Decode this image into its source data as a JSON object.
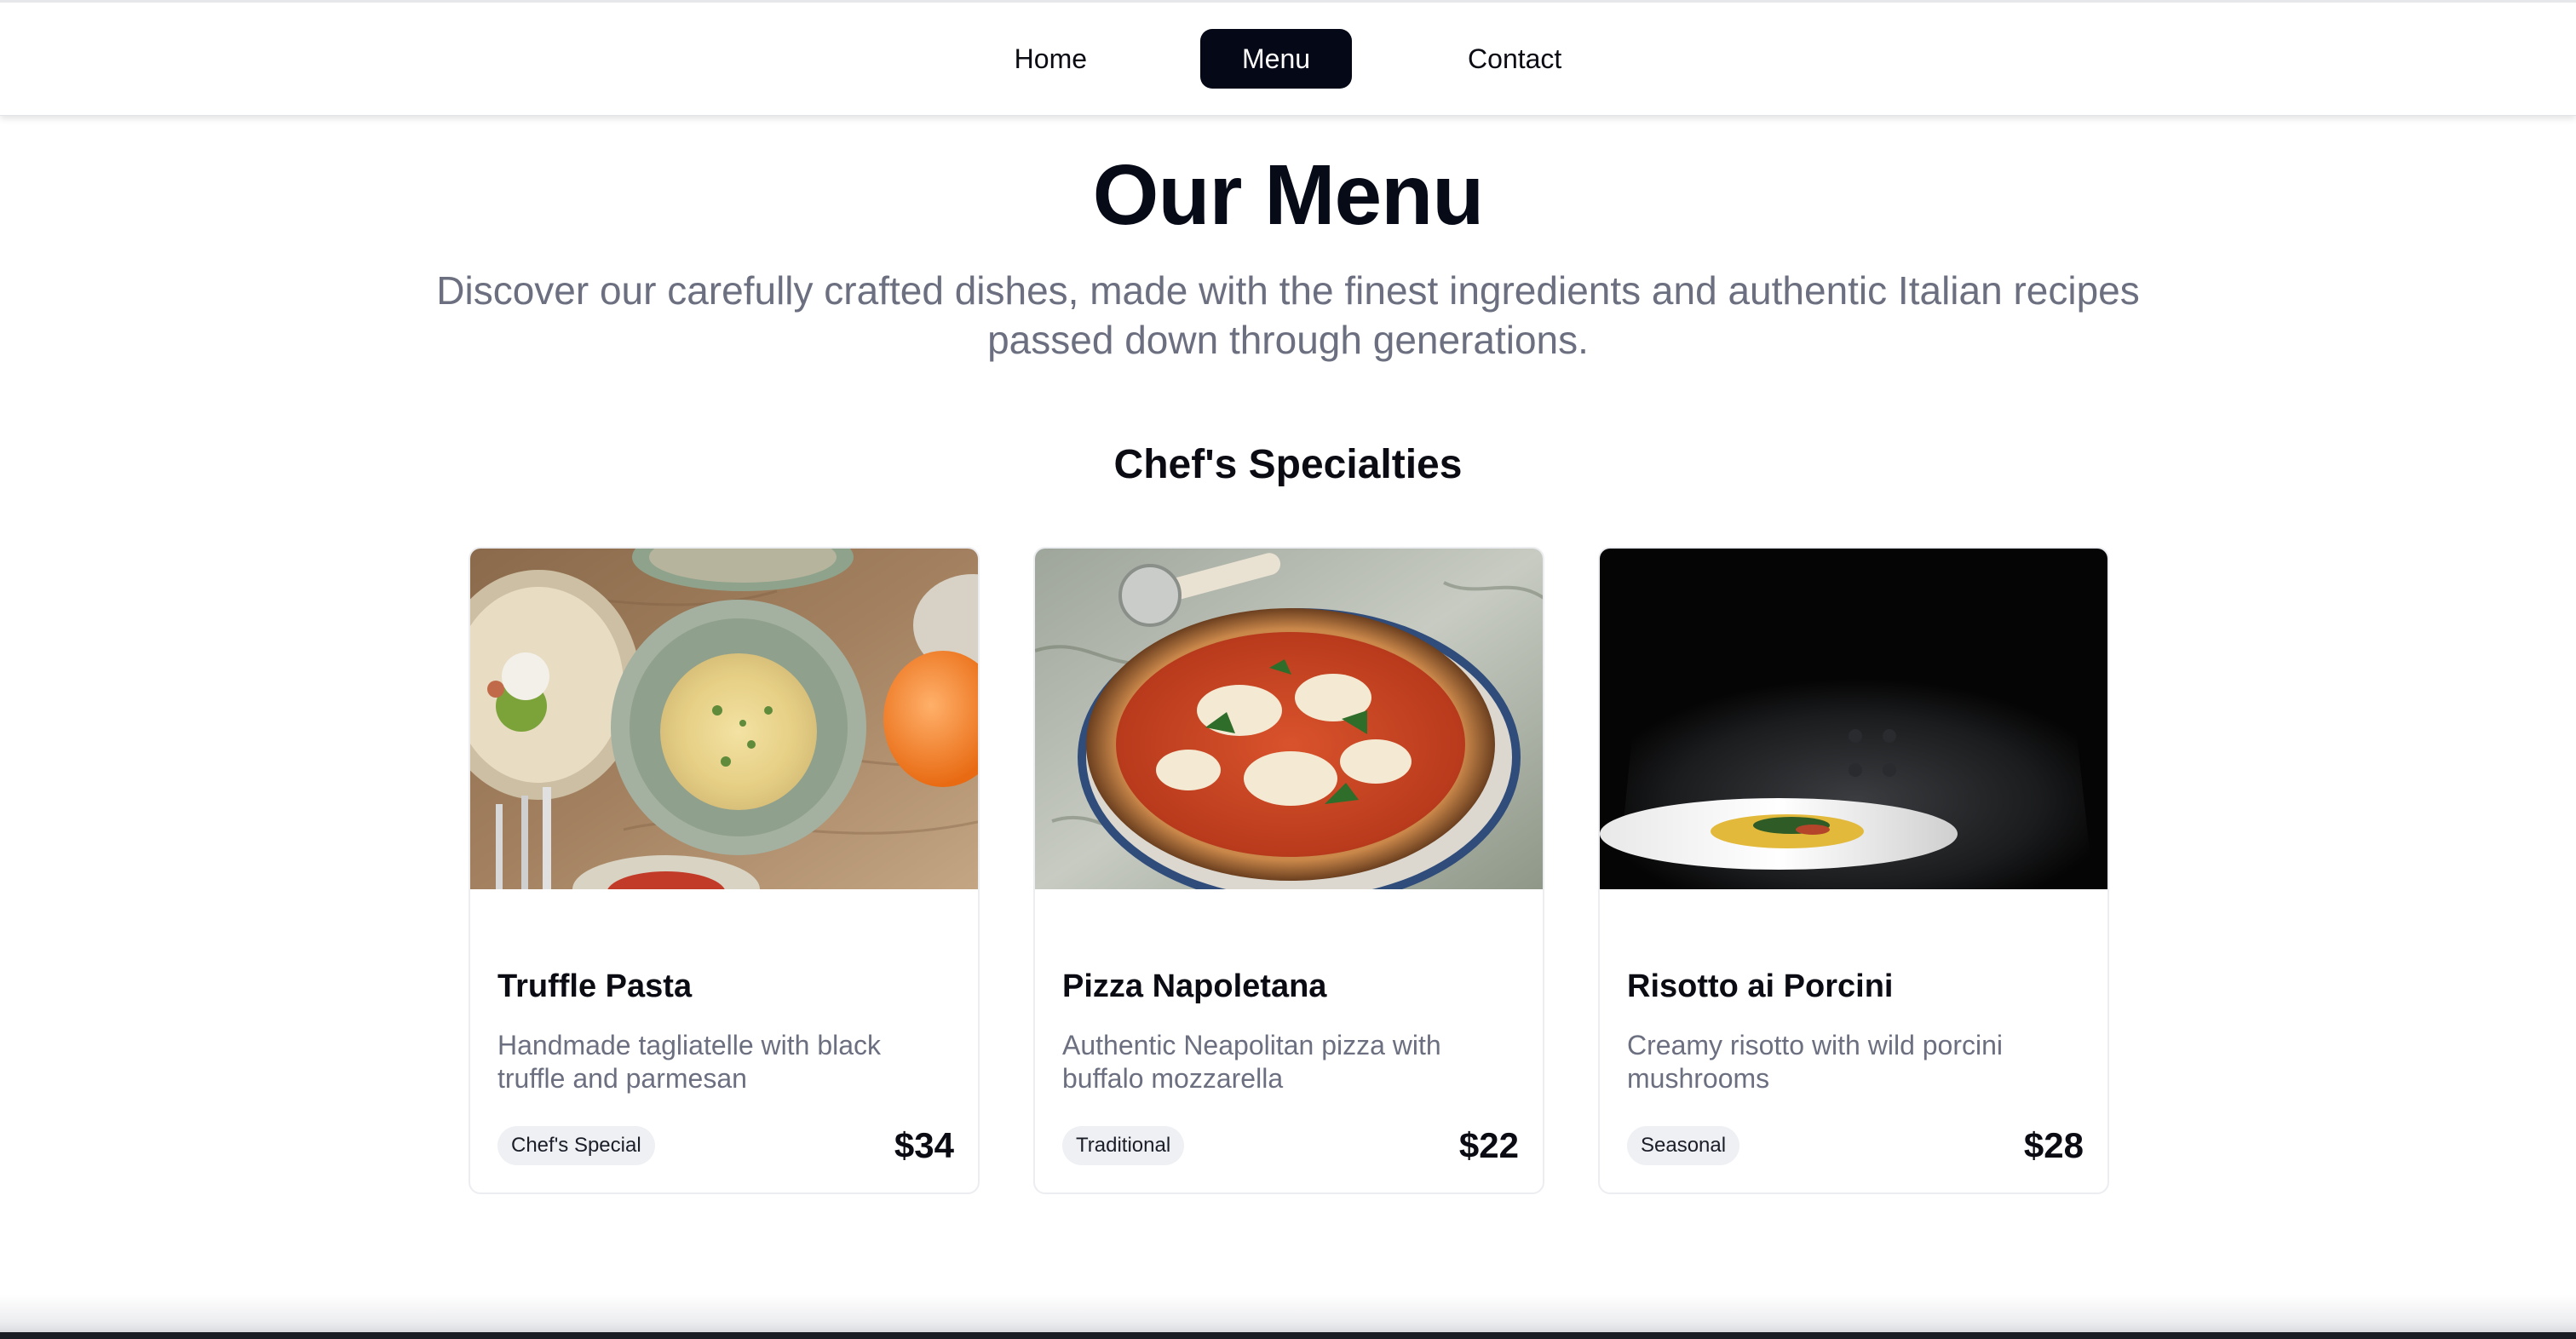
{
  "nav": {
    "items": [
      {
        "label": "Home",
        "active": false
      },
      {
        "label": "Menu",
        "active": true
      },
      {
        "label": "Contact",
        "active": false
      }
    ]
  },
  "hero": {
    "title": "Our Menu",
    "subtitle": "Discover our carefully crafted dishes, made with the finest ingredients and authentic Italian recipes passed down through generations."
  },
  "section": {
    "title": "Chef's Specialties"
  },
  "cards": [
    {
      "name": "Truffle Pasta",
      "description": "Handmade tagliatelle with black truffle and parmesan",
      "tag": "Chef's Special",
      "price": "$34",
      "image_icon": "pasta-photo"
    },
    {
      "name": "Pizza Napoletana",
      "description": "Authentic Neapolitan pizza with buffalo mozzarella",
      "tag": "Traditional",
      "price": "$22",
      "image_icon": "pizza-photo"
    },
    {
      "name": "Risotto ai Porcini",
      "description": "Creamy risotto with wild porcini mushrooms",
      "tag": "Seasonal",
      "price": "$28",
      "image_icon": "chef-plate-photo"
    }
  ],
  "colors": {
    "active_nav_bg": "#050816",
    "text_primary": "#0b0b14",
    "text_muted": "#6b6f80",
    "tag_bg": "#eef0f3"
  }
}
